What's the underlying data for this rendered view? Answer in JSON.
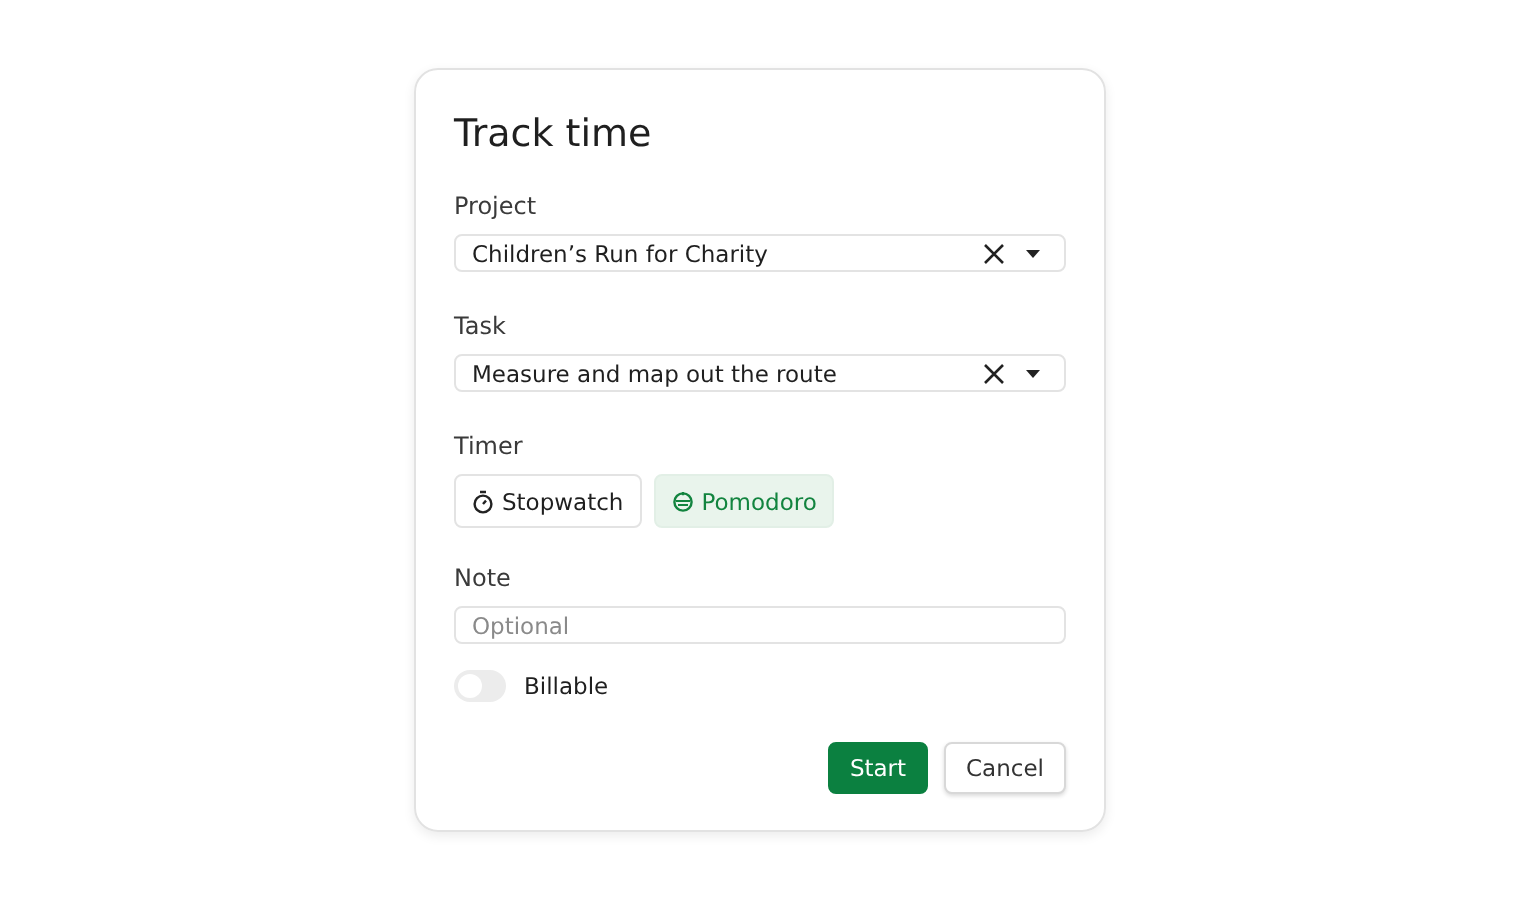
{
  "dialog": {
    "title": "Track time",
    "selects": [
      {
        "label": "Project",
        "value": "Children’s Run for Charity"
      },
      {
        "label": "Task",
        "value": "Measure and map out the route"
      }
    ],
    "timer": {
      "label": "Timer",
      "options": [
        {
          "kind": "stopwatch",
          "label": "Stopwatch",
          "selected": false
        },
        {
          "kind": "pomodoro",
          "label": "Pomodoro",
          "selected": true
        }
      ]
    },
    "note": {
      "label": "Note",
      "placeholder": "Optional"
    },
    "billable": {
      "label": "Billable",
      "on": false
    },
    "buttons": [
      {
        "kind": "primary",
        "label": "Start"
      },
      {
        "kind": "secondary",
        "label": "Cancel"
      }
    ]
  }
}
